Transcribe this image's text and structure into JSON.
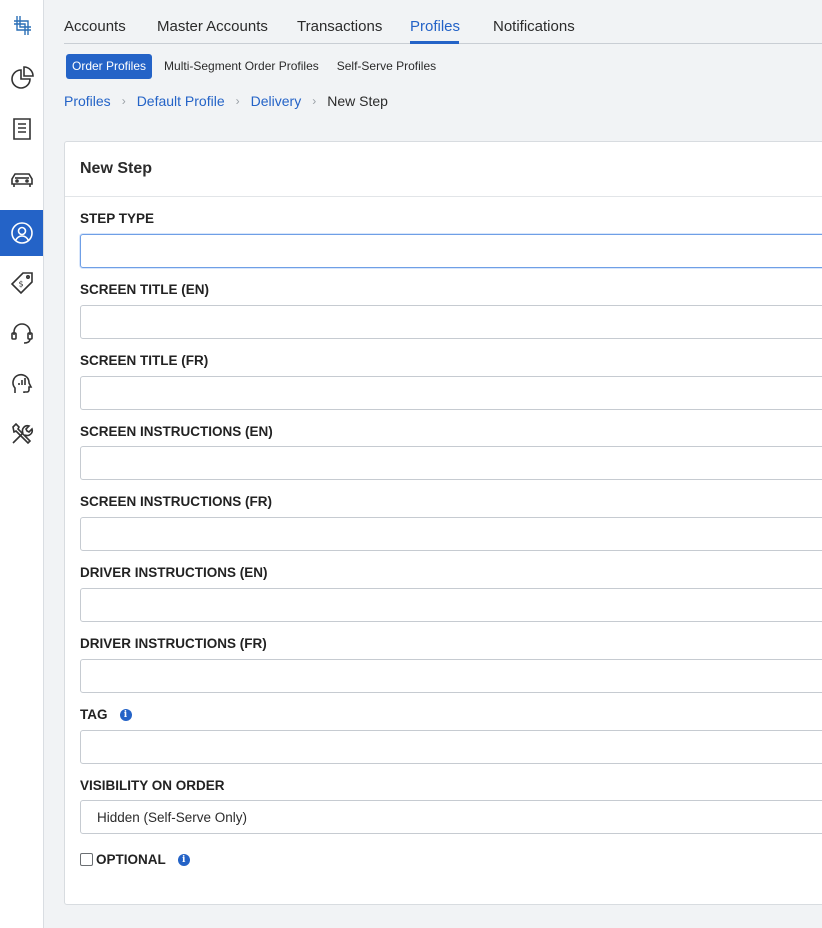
{
  "nav": {
    "tabs": [
      {
        "label": "Accounts"
      },
      {
        "label": "Master Accounts"
      },
      {
        "label": "Transactions"
      },
      {
        "label": "Profiles"
      },
      {
        "label": "Notifications"
      }
    ],
    "active_tab": "Profiles"
  },
  "subnav": {
    "items": [
      {
        "label": "Order Profiles"
      },
      {
        "label": "Multi-Segment Order Profiles"
      },
      {
        "label": "Self-Serve Profiles"
      }
    ],
    "active": "Order Profiles"
  },
  "breadcrumb": {
    "items": [
      "Profiles",
      "Default Profile",
      "Delivery"
    ],
    "current": "New Step",
    "separator": "›"
  },
  "sidebar": {
    "items": [
      "logo-icon",
      "pie-chart-icon",
      "receipt-icon",
      "car-icon",
      "user-profile-icon",
      "price-tag-icon",
      "headset-icon",
      "analytics-head-icon",
      "tools-icon"
    ],
    "active": "user-profile-icon"
  },
  "form": {
    "title": "New Step",
    "fields": [
      {
        "label": "STEP TYPE",
        "value": ""
      },
      {
        "label": "SCREEN TITLE (EN)",
        "value": ""
      },
      {
        "label": "SCREEN TITLE (FR)",
        "value": ""
      },
      {
        "label": "SCREEN INSTRUCTIONS (EN)",
        "value": ""
      },
      {
        "label": "SCREEN INSTRUCTIONS (FR)",
        "value": ""
      },
      {
        "label": "DRIVER INSTRUCTIONS (EN)",
        "value": ""
      },
      {
        "label": "DRIVER INSTRUCTIONS (FR)",
        "value": ""
      },
      {
        "label": "TAG",
        "value": ""
      }
    ],
    "visibility": {
      "label": "VISIBILITY ON ORDER",
      "value": "Hidden (Self-Serve Only)"
    },
    "optional": {
      "label": "OPTIONAL",
      "checked": false
    },
    "info_glyph": "i"
  },
  "colors": {
    "accent": "#2463c7",
    "page_bg": "#f1f3f5",
    "card_bg": "#ffffff"
  }
}
